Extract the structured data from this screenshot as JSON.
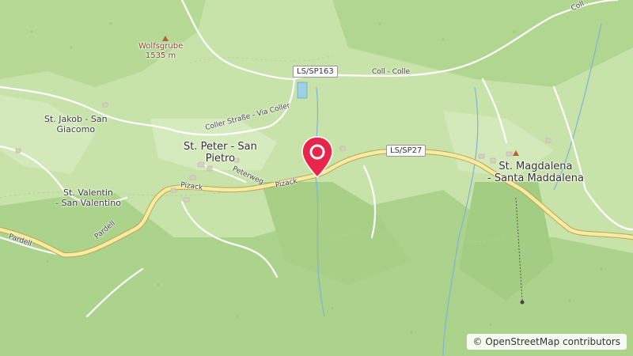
{
  "map": {
    "attribution": "© OpenStreetMap contributors",
    "marker": "location-pin"
  },
  "places": {
    "st_peter": "St. Peter - San\nPietro",
    "st_jakob": "St. Jakob - San\nGiacomo",
    "st_valentin": "St. Valentin\n- San Valentino",
    "st_magdalena": "St. Magdalena\n- Santa Maddalena",
    "wolfsgrube": "Wolfsgrube\n1535 m"
  },
  "roads": {
    "sp163": "LS/SP163",
    "sp27": "LS/SP27",
    "coll_colle": "Coll - Colle",
    "coll_top": "Coll",
    "coller_strasse": "Coller Straße - Via Coller",
    "peterweg": "Peterweg",
    "pizack_west": "Pizack",
    "pizack_east": "Pizack",
    "pardell_west": "Pardell",
    "pardell_east": "Pardell"
  }
}
